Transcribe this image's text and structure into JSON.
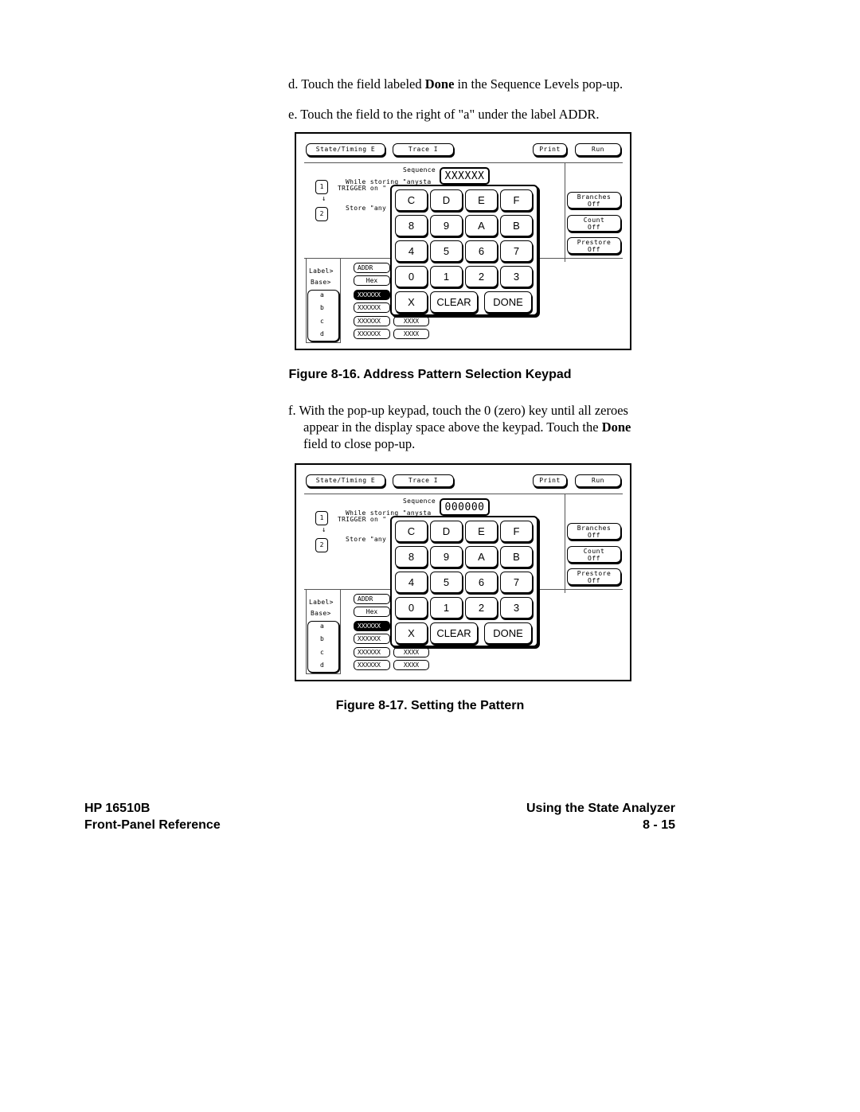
{
  "steps": {
    "d": {
      "prefix": "d. Touch the field labeled ",
      "bold": "Done",
      "suffix": " in the Sequence Levels pop-up."
    },
    "e": {
      "text": "e. Touch the field to the right of \"a\" under the label ADDR."
    },
    "f": {
      "line1": "f. With the pop-up keypad, touch the 0 (zero) key until all zeroes",
      "line2_prefix": "appear in the display space above the keypad. Touch the ",
      "line2_bold": "Done",
      "line3": "field to close pop-up."
    }
  },
  "figures": [
    {
      "caption": "Figure 8-16. Address Pattern Selection Keypad",
      "screen": {
        "menu": {
          "state_timing": "State/Timing E",
          "trace": "Trace I",
          "print": "Print",
          "run": "Run"
        },
        "sequence_label": "Sequence",
        "display_value": "XXXXXX",
        "levels": [
          {
            "number": "1",
            "line1": "While storing \"anysta",
            "line2": "TRIGGER on \""
          },
          {
            "number": "2",
            "line1": "Store \"any"
          }
        ],
        "side_buttons": [
          {
            "title": "Branches",
            "value": "Off"
          },
          {
            "title": "Count",
            "value": "Off"
          },
          {
            "title": "Prestore",
            "value": "Off"
          }
        ],
        "label_row": {
          "label_caption": "Label>",
          "base_caption": "Base>",
          "label_value": "ADDR",
          "base_value": "Hex"
        },
        "terms": [
          "a",
          "b",
          "c",
          "d"
        ],
        "term_values": [
          "XXXXXX",
          "XXXXXX",
          "XXXXXX",
          "XXXXXX"
        ],
        "term_values_2": [
          "",
          "",
          "XXXX",
          "XXXX"
        ],
        "keys": [
          [
            "C",
            "D",
            "E",
            "F"
          ],
          [
            "8",
            "9",
            "A",
            "B"
          ],
          [
            "4",
            "5",
            "6",
            "7"
          ],
          [
            "0",
            "1",
            "2",
            "3"
          ]
        ],
        "bottom_keys": {
          "x": "X",
          "clear": "CLEAR",
          "done": "DONE"
        }
      }
    },
    {
      "caption": "Figure 8-17. Setting the Pattern",
      "screen": {
        "menu": {
          "state_timing": "State/Timing E",
          "trace": "Trace I",
          "print": "Print",
          "run": "Run"
        },
        "sequence_label": "Sequence",
        "display_value": "000000",
        "levels": [
          {
            "number": "1",
            "line1": "While storing \"anysta",
            "line2": "TRIGGER on \""
          },
          {
            "number": "2",
            "line1": "Store \"any"
          }
        ],
        "side_buttons": [
          {
            "title": "Branches",
            "value": "Off"
          },
          {
            "title": "Count",
            "value": "Off"
          },
          {
            "title": "Prestore",
            "value": "Off"
          }
        ],
        "label_row": {
          "label_caption": "Label>",
          "base_caption": "Base>",
          "label_value": "ADDR",
          "base_value": "Hex"
        },
        "terms": [
          "a",
          "b",
          "c",
          "d"
        ],
        "term_values": [
          "XXXXXX",
          "XXXXXX",
          "XXXXXX",
          "XXXXXX"
        ],
        "term_values_2": [
          "",
          "",
          "XXXX",
          "XXXX"
        ],
        "keys": [
          [
            "C",
            "D",
            "E",
            "F"
          ],
          [
            "8",
            "9",
            "A",
            "B"
          ],
          [
            "4",
            "5",
            "6",
            "7"
          ],
          [
            "0",
            "1",
            "2",
            "3"
          ]
        ],
        "bottom_keys": {
          "x": "X",
          "clear": "CLEAR",
          "done": "DONE"
        }
      }
    }
  ],
  "footer": {
    "left_line1": "HP 16510B",
    "left_line2": "Front-Panel Reference",
    "right_line1": "Using the State Analyzer",
    "right_line2": "8 - 15"
  }
}
